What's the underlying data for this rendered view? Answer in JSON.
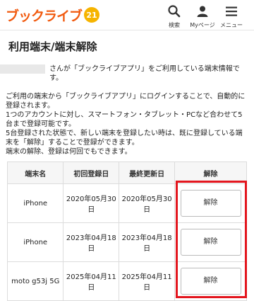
{
  "header": {
    "logo_text": "ブックライブ",
    "logo_badge": "21",
    "nav": [
      {
        "label": "検索",
        "icon": "search-icon"
      },
      {
        "label": "Myページ",
        "icon": "user-icon"
      },
      {
        "label": "メニュー",
        "icon": "hamburger-menu-icon"
      }
    ]
  },
  "page": {
    "title": "利用端末/端末解除",
    "intro_line1": "さんが「ブックライブアプリ」をご利用している端末情報です。",
    "intro_line2": "ご利用の端末から「ブックライブアプリ」にログインすることで、自動的に登録されます。",
    "intro_line3": "1つのアカウントに対し、スマートフォン・タブレット・PCなど合わせて5台まで登録可能です。",
    "intro_line4": "5台登録された状態で、新しい端末を登録したい時は、既に登録している端末を「解除」することで登録ができます。",
    "intro_line5": "端末の解除、登録は何回でもできます。"
  },
  "table": {
    "headers": [
      "端末名",
      "初回登録日",
      "最終更新日",
      "解除"
    ],
    "rows": [
      {
        "device": "iPhone",
        "first": "2020年05月30日",
        "last": "2020年05月30日",
        "action": "解除"
      },
      {
        "device": "iPhone",
        "first": "2023年04月18日",
        "last": "2023年04月18日",
        "action": "解除"
      },
      {
        "device": "moto g53j 5G",
        "first": "2025年04月11日",
        "last": "2025年04月11日",
        "action": "解除"
      }
    ]
  },
  "colors": {
    "brand": "#f15a0f",
    "highlight": "#e3161e"
  }
}
